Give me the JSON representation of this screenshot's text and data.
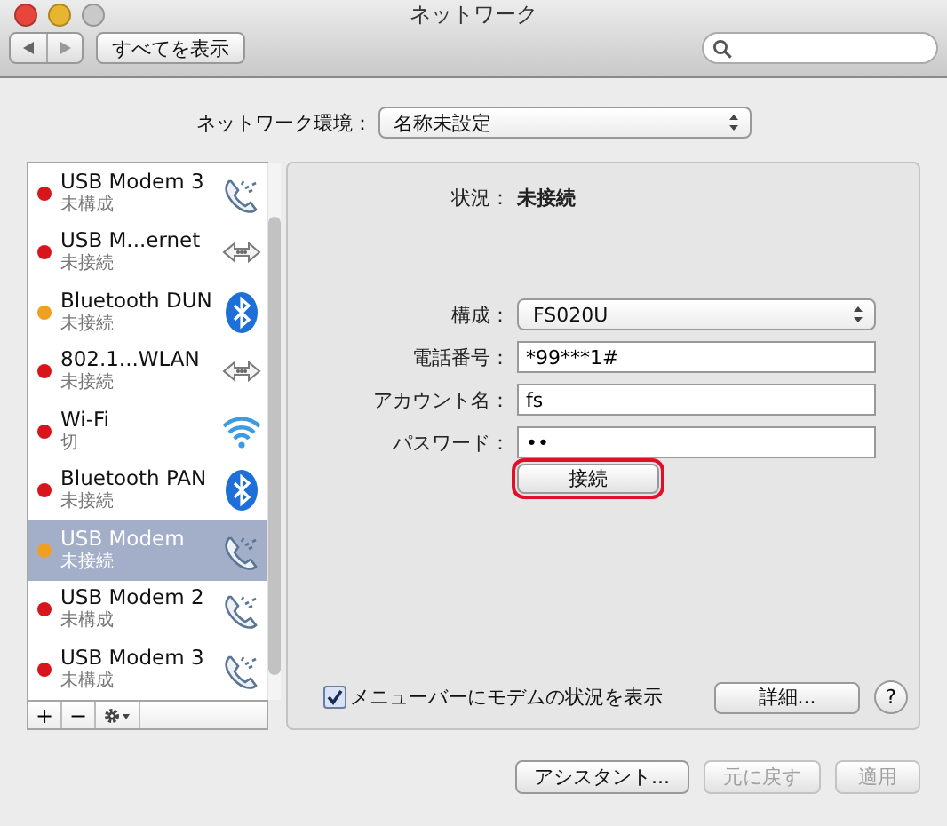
{
  "window": {
    "title": "ネットワーク"
  },
  "toolbar": {
    "show_all": "すべてを表示"
  },
  "location": {
    "label": "ネットワーク環境：",
    "value": "名称未設定"
  },
  "services": [
    {
      "name": "USB Modem 3",
      "status": "未構成",
      "color": "#d8151b",
      "kind": "phone",
      "selected": false
    },
    {
      "name": "USB M...ernet",
      "status": "未接続",
      "color": "#d8151b",
      "kind": "ethernet",
      "selected": false
    },
    {
      "name": "Bluetooth DUN",
      "status": "未接続",
      "color": "#f0a020",
      "kind": "bluetooth",
      "selected": false
    },
    {
      "name": "802.1...WLAN",
      "status": "未接続",
      "color": "#d8151b",
      "kind": "ethernet",
      "selected": false
    },
    {
      "name": "Wi-Fi",
      "status": "切",
      "color": "#d8151b",
      "kind": "wifi",
      "selected": false
    },
    {
      "name": "Bluetooth PAN",
      "status": "未接続",
      "color": "#d8151b",
      "kind": "bluetooth",
      "selected": false
    },
    {
      "name": "USB Modem",
      "status": "未接続",
      "color": "#f0a020",
      "kind": "phone",
      "selected": true
    },
    {
      "name": "USB Modem 2",
      "status": "未構成",
      "color": "#d8151b",
      "kind": "phone",
      "selected": false
    },
    {
      "name": "USB Modem 3",
      "status": "未構成",
      "color": "#d8151b",
      "kind": "phone",
      "selected": false
    }
  ],
  "list_buttons": [
    "+",
    "−"
  ],
  "detail": {
    "status_label": "状況：",
    "status_value": "未接続",
    "fields": [
      {
        "kind": "popup",
        "label": "構成：",
        "value": "FS020U"
      },
      {
        "kind": "text",
        "label": "電話番号：",
        "value": "*99***1#"
      },
      {
        "kind": "text",
        "label": "アカウント名：",
        "value": "fs"
      },
      {
        "kind": "text",
        "label": "パスワード：",
        "value": "••"
      }
    ],
    "connect": {
      "label": "接続",
      "highlighted": true
    },
    "show_status": {
      "label": "メニューバーにモデムの状況を表示",
      "checked": true
    },
    "advanced": "詳細...",
    "help": "?"
  },
  "footer": [
    {
      "label": "アシスタント...",
      "disabled": false
    },
    {
      "label": "元に戻す",
      "disabled": true
    },
    {
      "label": "適用",
      "disabled": true
    }
  ]
}
